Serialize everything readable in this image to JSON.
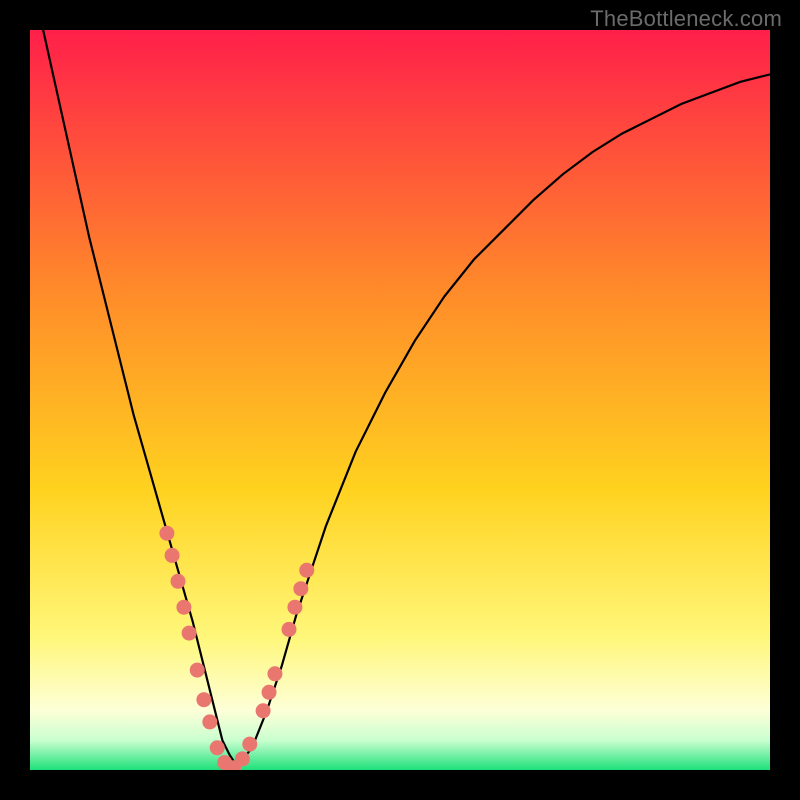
{
  "watermark": "TheBottleneck.com",
  "colors": {
    "frame_bg": "#000000",
    "gradient_top": "#ff1f4a",
    "gradient_mid1": "#ff6a2a",
    "gradient_mid2": "#ffd21f",
    "gradient_mid3": "#fff99a",
    "gradient_mid4": "#fdffd0",
    "gradient_bottom": "#1ee07a",
    "curve": "#000000",
    "marker": "#e9776f"
  },
  "chart_data": {
    "type": "line",
    "title": "",
    "xlabel": "",
    "ylabel": "",
    "xlim": [
      0,
      100
    ],
    "ylim": [
      0,
      100
    ],
    "series": [
      {
        "name": "bottleneck-curve",
        "x": [
          0,
          2,
          4,
          6,
          8,
          10,
          12,
          14,
          16,
          18,
          20,
          22,
          23,
          24,
          25,
          26,
          27,
          28,
          30,
          32,
          34,
          36,
          38,
          40,
          44,
          48,
          52,
          56,
          60,
          64,
          68,
          72,
          76,
          80,
          84,
          88,
          92,
          96,
          100
        ],
        "y": [
          108,
          99,
          90,
          81,
          72,
          64,
          56,
          48,
          41,
          34,
          27,
          20,
          16,
          12,
          8,
          4,
          2,
          0.5,
          3,
          8,
          14,
          21,
          27,
          33,
          43,
          51,
          58,
          64,
          69,
          73,
          77,
          80.5,
          83.5,
          86,
          88,
          90,
          91.5,
          93,
          94
        ]
      }
    ],
    "markers": {
      "name": "highlight-points",
      "points": [
        {
          "x": 18.5,
          "y": 32
        },
        {
          "x": 19.2,
          "y": 29
        },
        {
          "x": 20.0,
          "y": 25.5
        },
        {
          "x": 20.8,
          "y": 22
        },
        {
          "x": 21.5,
          "y": 18.5
        },
        {
          "x": 22.6,
          "y": 13.5
        },
        {
          "x": 23.5,
          "y": 9.5
        },
        {
          "x": 24.3,
          "y": 6.5
        },
        {
          "x": 25.3,
          "y": 3.0
        },
        {
          "x": 26.3,
          "y": 1.0
        },
        {
          "x": 27.5,
          "y": 0.3
        },
        {
          "x": 28.7,
          "y": 1.5
        },
        {
          "x": 29.7,
          "y": 3.5
        },
        {
          "x": 31.5,
          "y": 8.0
        },
        {
          "x": 32.3,
          "y": 10.5
        },
        {
          "x": 33.1,
          "y": 13.0
        },
        {
          "x": 35.0,
          "y": 19.0
        },
        {
          "x": 35.8,
          "y": 22.0
        },
        {
          "x": 36.6,
          "y": 24.5
        },
        {
          "x": 37.4,
          "y": 27.0
        }
      ]
    }
  }
}
